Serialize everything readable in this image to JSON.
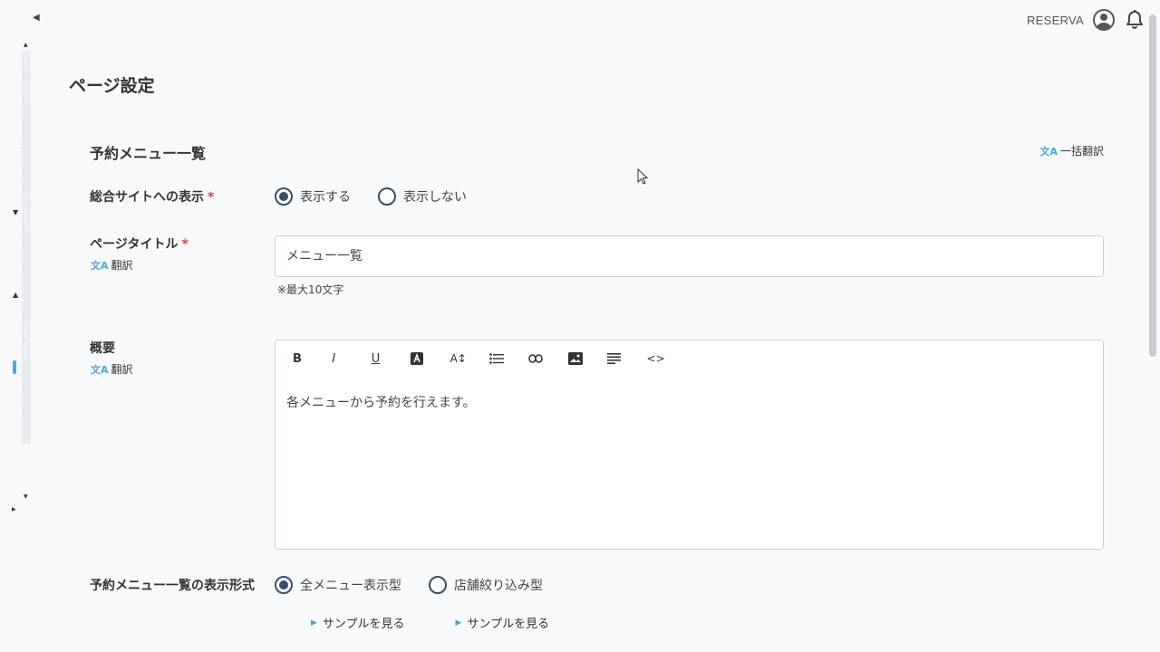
{
  "header": {
    "brand": "RESERVA",
    "avatar_icon": "account-circle-icon",
    "bell_icon": "bell-icon"
  },
  "page": {
    "title": "ページ設定"
  },
  "section": {
    "title": "予約メニュー一覧",
    "bulk_translate": "一括翻訳"
  },
  "fields": {
    "site_display": {
      "label": "総合サイトへの表示",
      "required": "*",
      "options": [
        "表示する",
        "表示しない"
      ],
      "selected": "表示する"
    },
    "page_title": {
      "label": "ページタイトル",
      "required": "*",
      "translate": "翻訳",
      "value": "メニュー一覧",
      "hint": "※最大10文字"
    },
    "summary": {
      "label": "概要",
      "translate": "翻訳",
      "toolbar": [
        "B",
        "I",
        "U",
        "A",
        "A↕",
        "list",
        "link",
        "image",
        "align",
        "<>"
      ],
      "content": "各メニューから予約を行えます。"
    },
    "display_type": {
      "label": "予約メニュー一覧の表示形式",
      "options": [
        "全メニュー表示型",
        "店舗絞り込み型"
      ],
      "selected": "全メニュー表示型",
      "sample_link": "サンプルを見る"
    }
  },
  "colors": {
    "accent": "#4aa8d8",
    "radio": "#3a4d6b",
    "required": "#d64545",
    "background": "#f7f9fb"
  }
}
